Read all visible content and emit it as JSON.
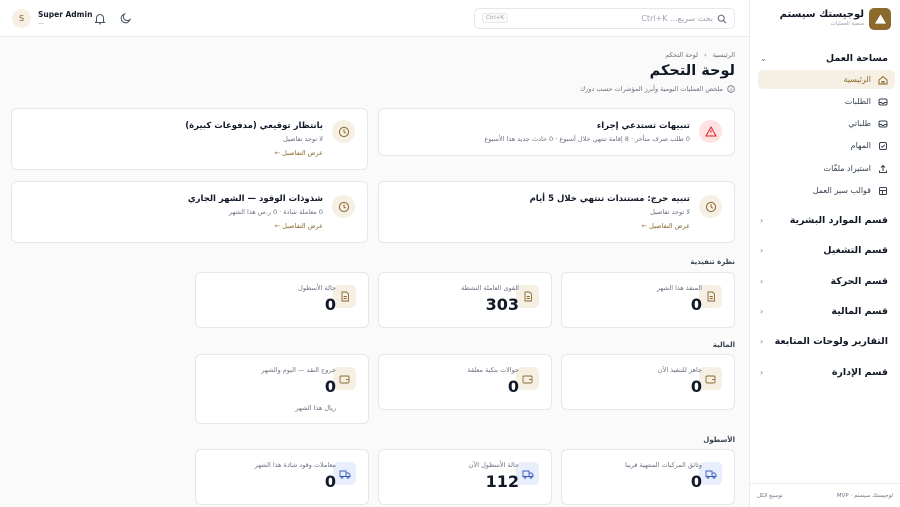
{
  "brand": {
    "title": "لوجيستك سيستم",
    "subtitle": "منصة العمليات"
  },
  "search": {
    "placeholder": "بحث سريع... Ctrl+K",
    "shortcut": "Ctrl+K"
  },
  "user": {
    "name": "Super Admin",
    "role": "—",
    "initial": "S"
  },
  "sidebar": {
    "workspace_label": "مساحة العمل",
    "items": [
      {
        "label": "الرئيسية",
        "icon": "home-icon",
        "active": true
      },
      {
        "label": "الطلبات",
        "icon": "inbox-icon"
      },
      {
        "label": "طلباتي",
        "icon": "inbox-icon"
      },
      {
        "label": "المهام",
        "icon": "checkbox-icon"
      },
      {
        "label": "استيراد ملفّات",
        "icon": "upload-icon"
      },
      {
        "label": "قوالب سير العمل",
        "icon": "template-icon"
      }
    ],
    "sections": [
      "قسم الموارد البشرية",
      "قسم التشغيل",
      "قسم الحركة",
      "قسم المالية",
      "التقارير ولوحات المتابعة",
      "قسم الإدارة"
    ],
    "footer_left": "لوجيستك سيستم · MVP",
    "footer_right": "توسيع الكل"
  },
  "breadcrumb": {
    "home": "الرئيسية",
    "current": "لوحة التحكم"
  },
  "page": {
    "title": "لوحة التحكم",
    "subtitle": "ملخص العمليات اليومية وأبرز المؤشرات حسب دورك"
  },
  "alerts": [
    {
      "title": "تنبيهات تستدعي إجراء",
      "desc": "0 طلب صرف متأخر · 8 إقامة تنتهي خلال أسبوع · 0 حادث جديد هذا الأسبوع",
      "link": "",
      "color": "#dc2626"
    },
    {
      "title": "بانتظار توقيعي (مدفوعات كبيرة)",
      "desc": "لا توجد تفاصيل",
      "link": "عرض التفاصيل ←",
      "color": "#8b6a2c"
    },
    {
      "title": "تنبيه حرج: مستندات تنتهي خلال 5 أيام",
      "desc": "لا توجد تفاصيل",
      "link": "عرض التفاصيل ←",
      "color": "#8b6a2c"
    },
    {
      "title": "شذوذات الوقود — الشهر الجاري",
      "desc": "0 معاملة شاذة · 0 ر.س هذا الشهر",
      "link": "عرض التفاصيل ←",
      "color": "#8b6a2c"
    }
  ],
  "sections": {
    "executive": "نظرة تنفيذية",
    "finance": "المالية",
    "fleet": "الأسطول"
  },
  "cards": [
    {
      "label": "المنفذ هذا الشهر",
      "value": "0",
      "sub": ""
    },
    {
      "label": "القوى العاملة النشطة",
      "value": "303",
      "sub": ""
    },
    {
      "label": "حالة الأسطول",
      "value": "0",
      "sub": ""
    },
    {
      "label": "جاهز للتنفيذ الآن",
      "value": "0",
      "sub": ""
    },
    {
      "label": "حوالات بنكية معلقة",
      "value": "0",
      "sub": ""
    },
    {
      "label": "خروج النقد — اليوم والشهر",
      "value": "0",
      "sub": "ريال هذا الشهر"
    },
    {
      "label": "وثائق المركبات المنتهية قريبا",
      "value": "0",
      "sub": ""
    },
    {
      "label": "حالة الأسطول الآن",
      "value": "112",
      "sub": ""
    },
    {
      "label": "معاملات وقود شاذة هذا الشهر",
      "value": "0",
      "sub": ""
    }
  ]
}
